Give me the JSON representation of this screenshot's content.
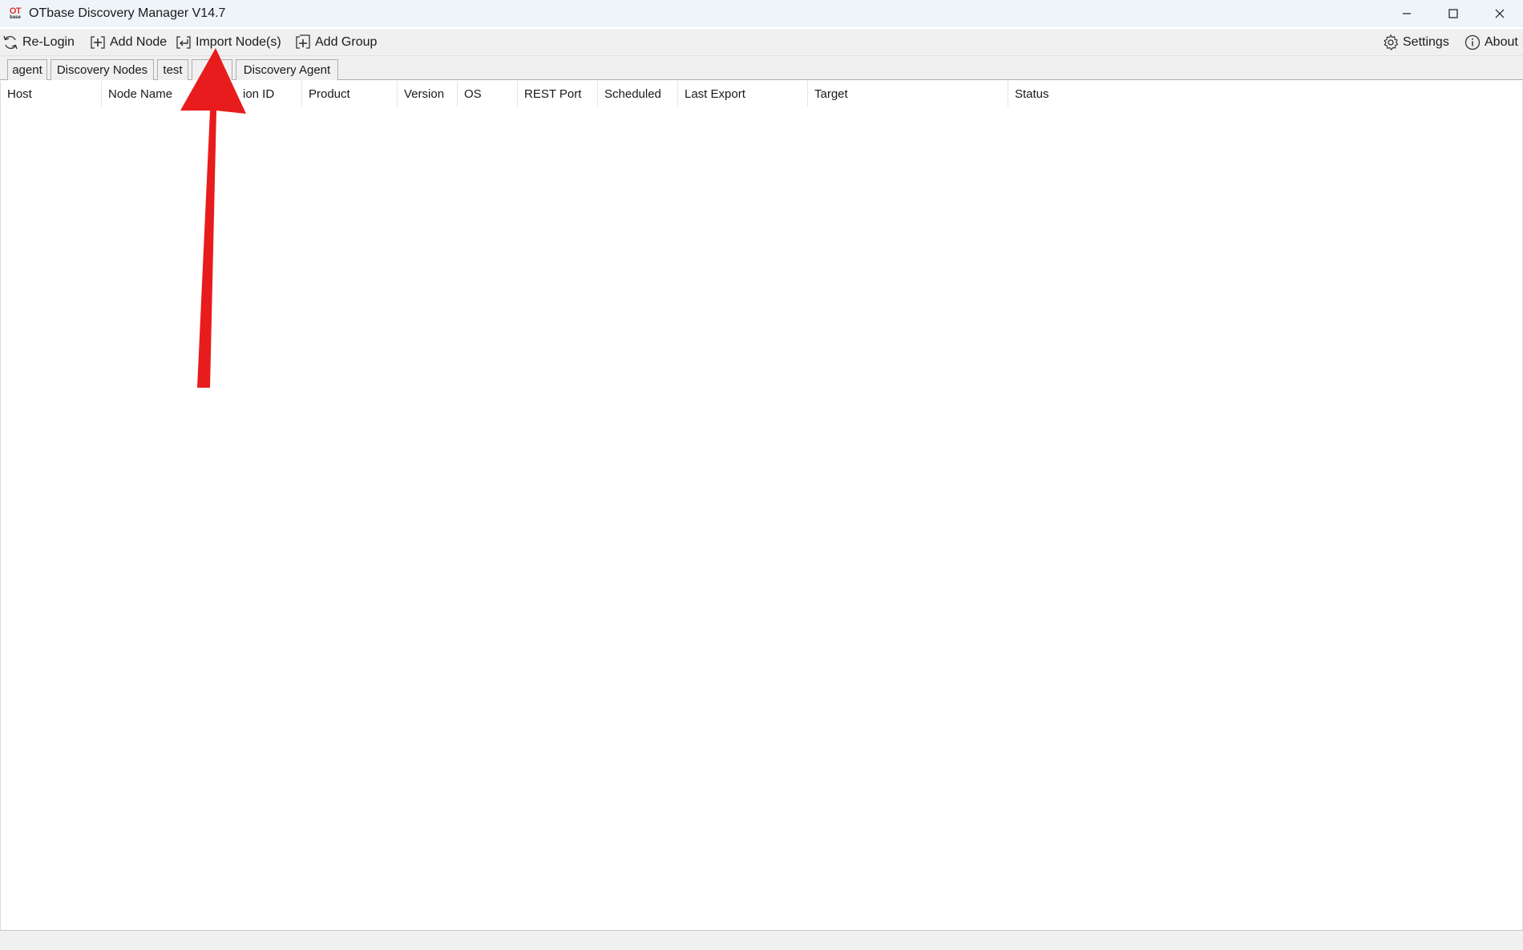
{
  "window": {
    "title": "OTbase Discovery Manager V14.7",
    "logo_text_top": "OT",
    "logo_text_bottom": "base"
  },
  "toolbar": {
    "relogin_label": "Re-Login",
    "add_node_label": "Add Node",
    "import_nodes_label": "Import Node(s)",
    "add_group_label": "Add Group",
    "settings_label": "Settings",
    "about_label": "About"
  },
  "tabs": [
    {
      "label": "agent"
    },
    {
      "label": "Discovery Nodes"
    },
    {
      "label": "test"
    },
    {
      "label": "ore"
    },
    {
      "label": "Discovery Agent"
    }
  ],
  "table": {
    "columns": [
      "Host",
      "Node Name",
      "ion ID",
      "Product",
      "Version",
      "OS",
      "REST Port",
      "Scheduled",
      "Last Export",
      "Target",
      "Status"
    ],
    "rows": []
  },
  "annotation": {
    "arrow_color": "#e81c1c"
  },
  "icons": {
    "relogin": "refresh-icon",
    "add_node": "add-node-icon",
    "import_nodes": "import-icon",
    "add_group": "add-group-icon",
    "settings": "gear-icon",
    "about": "info-icon",
    "minimize": "minimize-icon",
    "maximize": "maximize-icon",
    "close": "close-icon"
  }
}
